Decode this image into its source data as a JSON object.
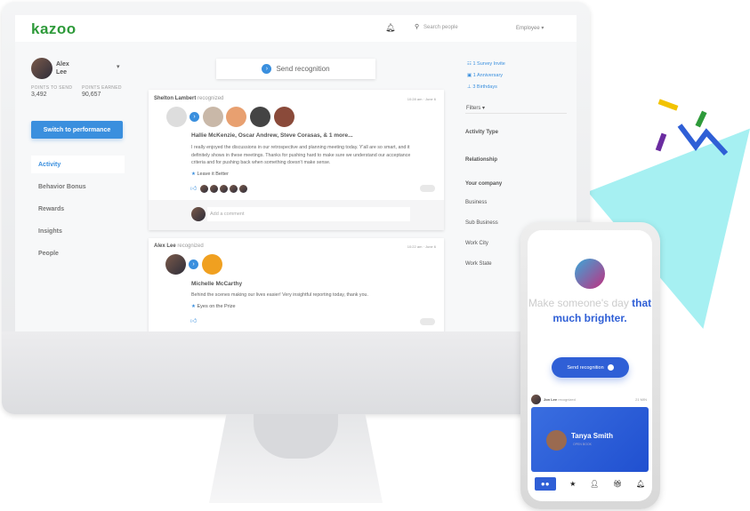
{
  "app": {
    "logo": "kazoo"
  },
  "topbar": {
    "search_placeholder": "Search people",
    "role": "Employee"
  },
  "user": {
    "first": "Alex",
    "last": "Lee",
    "points_to_send_label": "POINTS TO SEND",
    "points_to_send": "3,492",
    "points_earned_label": "POINTS EARNED",
    "points_earned": "90,657",
    "switch_button": "Switch to performance"
  },
  "nav": [
    {
      "label": "Activity"
    },
    {
      "label": "Behavior Bonus"
    },
    {
      "label": "Rewards"
    },
    {
      "label": "Insights"
    },
    {
      "label": "People"
    }
  ],
  "feed": {
    "send_button": "Send recognition",
    "comment_placeholder": "Add a comment",
    "posts": [
      {
        "author": "Shelton Lambert",
        "verb": "recognized",
        "time": "10:28 am · June 6",
        "recipients": "Hallie McKenzie, Oscar Andrew, Steve Corasas, & 1 more...",
        "message": "I really enjoyed the discussions in our retrospective and planning meeting today. Y'all are so smart, and it definitely shows in these meetings. Thanks for pushing hard to make sure we understand our acceptance criteria and for pushing back when something doesn't make sense.",
        "value": "Leave it Better"
      },
      {
        "author": "Alex Lee",
        "verb": "recognized",
        "time": "10:22 am · June 6",
        "recipients": "Michelle McCarthy",
        "message": "Behind the scenes making our lives easier! Very insightful reporting today, thank you.",
        "value": "Eyes on the Prize"
      }
    ]
  },
  "right": {
    "events": [
      {
        "label": "1 Survey Invite"
      },
      {
        "label": "1 Anniversary"
      },
      {
        "label": "3 Birthdays"
      }
    ],
    "filters_label": "Filters",
    "filters": [
      "Activity Type",
      "Relationship"
    ],
    "company_label": "Your company",
    "company_filters": [
      "Business",
      "Sub Business",
      "Work City",
      "Work State"
    ]
  },
  "phone": {
    "headline_light": "Make someone's day",
    "headline_bold": "that much brighter.",
    "send_button": "Send recognition",
    "feed_author": "Jon Lee",
    "feed_verb": "recognized",
    "feed_time": "21 MIN",
    "card_name": "Tanya Smith",
    "card_value": "OPEN BOOK"
  },
  "colors": {
    "brand_green": "#2e9a3a",
    "accent_blue": "#3a8fde",
    "phone_blue": "#2f5fd6",
    "triangle": "#a6f0f2"
  }
}
